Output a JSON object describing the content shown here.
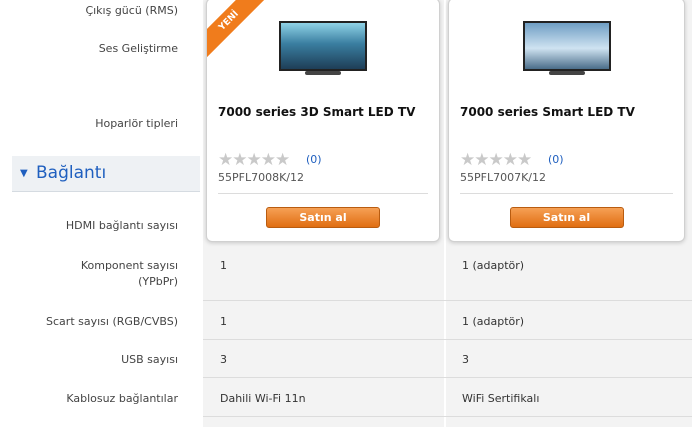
{
  "specs": {
    "cikis_gucu": "Çıkış gücü (RMS)",
    "ses_gelistirme": "Ses Geliştirme",
    "hoparlor": "Hoparlör tipleri"
  },
  "section": {
    "title": "Bağlantı"
  },
  "rows": {
    "hdmi": "HDMI bağlantı sayısı",
    "komponent": "Komponent sayısı\n(YPbPr)",
    "scart": "Scart sayısı (RGB/CVBS)",
    "usb": "USB sayısı",
    "kablosuz": "Kablosuz bağlantılar"
  },
  "products": [
    {
      "badge": "YENİ",
      "name": "7000 series 3D Smart LED TV",
      "rating_count": "(0)",
      "code": "55PFL7008K/12",
      "buy_label": "Satın al",
      "komponent": "1",
      "scart": "1",
      "usb": "3",
      "kablosuz": "Dahili Wi-Fi 11n"
    },
    {
      "name": "7000 series Smart LED TV",
      "rating_count": "(0)",
      "code": "55PFL7007K/12",
      "buy_label": "Satın al",
      "komponent": "1 (adaptör)",
      "scart": "1 (adaptör)",
      "usb": "3",
      "kablosuz": "WiFi Sertifikalı"
    }
  ],
  "colors": {
    "accent": "#1f5fbf",
    "button": "#f07c1c"
  },
  "icons": {
    "expand": "triangle-down-icon",
    "rating": "star-icon"
  }
}
